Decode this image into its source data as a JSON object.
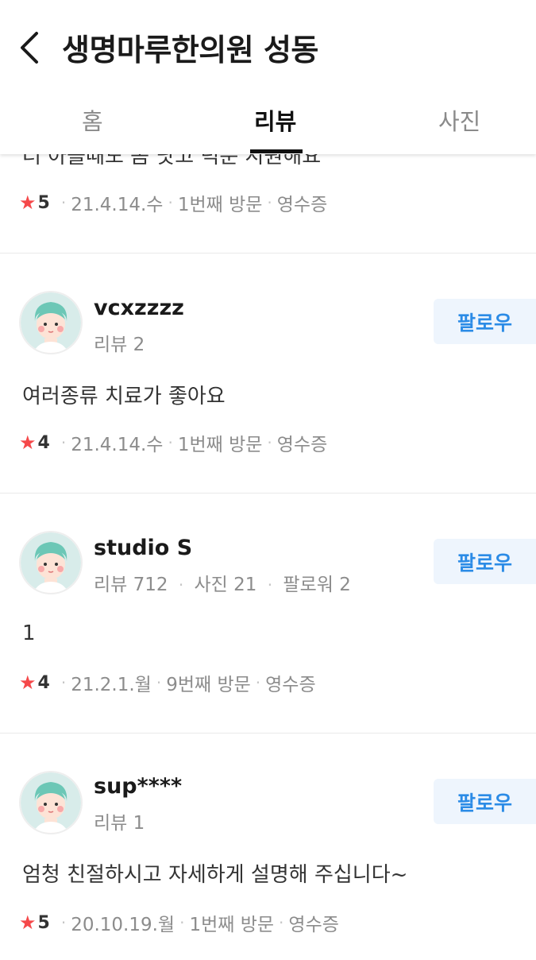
{
  "header": {
    "title": "생명마루한의원 성동",
    "tabs": [
      {
        "label": "홈",
        "active": false
      },
      {
        "label": "리뷰",
        "active": true
      },
      {
        "label": "사진",
        "active": false
      }
    ],
    "back_icon": "chevron-left-icon"
  },
  "truncated_review": {
    "text": "더 아플때도 좀 낫고 덕분 시원해요",
    "rating": "5",
    "date": "21.4.14.수",
    "visit": "1번째 방문",
    "receipt": "영수증"
  },
  "reviews": [
    {
      "author": "vcxzzzz",
      "stats": [
        "리뷰 2"
      ],
      "follow_label": "팔로우",
      "text": "여러종류 치료가 좋아요",
      "rating": "4",
      "date": "21.4.14.수",
      "visit": "1번째 방문",
      "receipt": "영수증"
    },
    {
      "author": "studio S",
      "stats": [
        "리뷰 712",
        "사진 21",
        "팔로워 2"
      ],
      "follow_label": "팔로우",
      "text": "1",
      "rating": "4",
      "date": "21.2.1.월",
      "visit": "9번째 방문",
      "receipt": "영수증"
    },
    {
      "author": "sup****",
      "stats": [
        "리뷰 1"
      ],
      "follow_label": "팔로우",
      "text": "엄청 친절하시고 자세하게 설명해 주십니다~",
      "rating": "5",
      "date": "20.10.19.월",
      "visit": "1번째 방문",
      "receipt": "영수증"
    }
  ],
  "colors": {
    "star": "#f5484a",
    "follow_text": "#2b8be6",
    "follow_bg": "#eef5fd"
  }
}
